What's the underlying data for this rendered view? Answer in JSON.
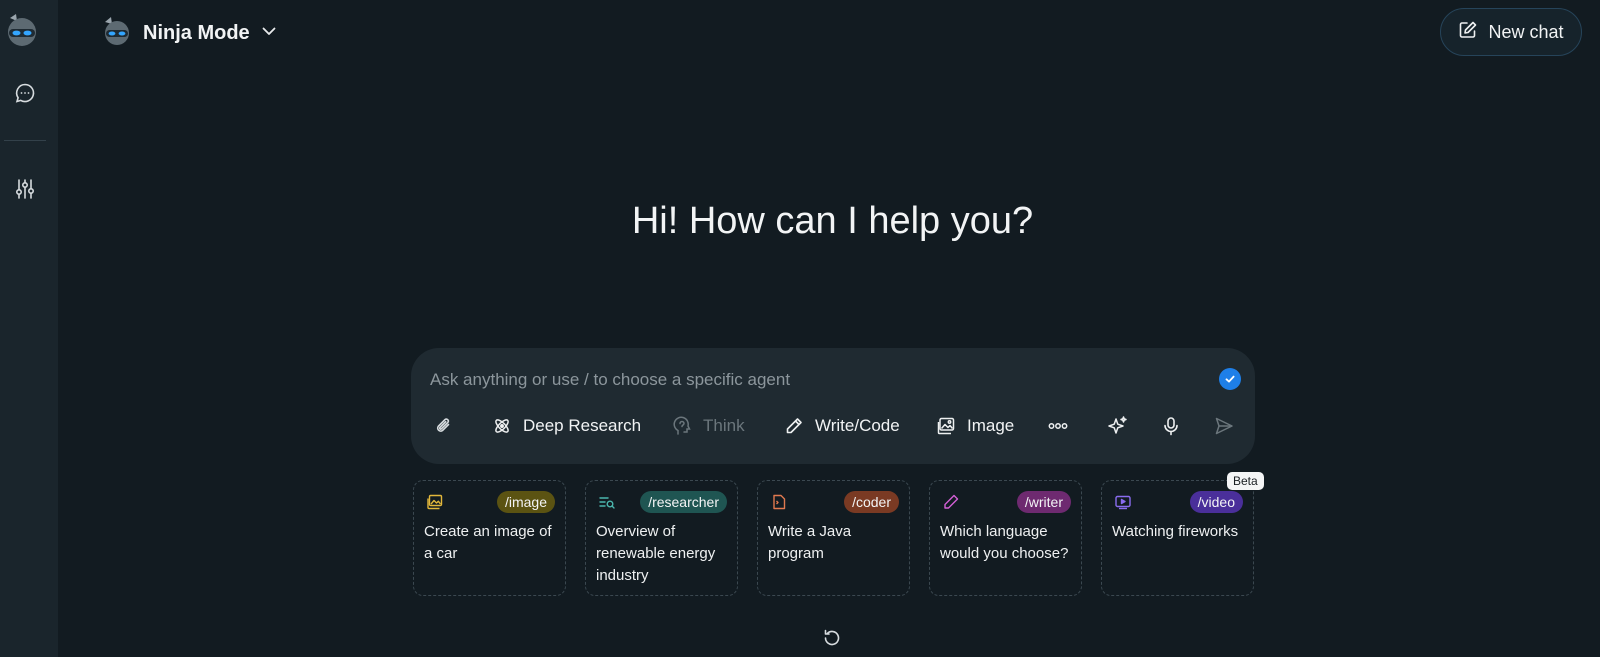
{
  "header": {
    "mode_label": "Ninja Mode",
    "new_chat_label": "New chat"
  },
  "sidebar": {
    "icons": [
      "ninja-logo-icon",
      "chat-bubble-icon",
      "sliders-icon"
    ]
  },
  "main": {
    "greeting": "Hi! How can I help you?"
  },
  "composer": {
    "placeholder": "Ask anything or use / to choose a specific agent",
    "value": "",
    "tools": {
      "deep_research": "Deep Research",
      "think": "Think",
      "write_code": "Write/Code",
      "image": "Image"
    }
  },
  "cards": [
    {
      "tag": "/image",
      "text": "Create an image of a car",
      "tag_color": "#5b5312",
      "icon_color": "#e2b73b"
    },
    {
      "tag": "/researcher",
      "text": "Overview of renewable energy industry",
      "tag_color": "#1f5552",
      "icon_color": "#4bb6ad"
    },
    {
      "tag": "/coder",
      "text": "Write a Java program",
      "tag_color": "#7a3a23",
      "icon_color": "#e0794f"
    },
    {
      "tag": "/writer",
      "text": "Which language would you choose?",
      "tag_color": "#6e2a70",
      "icon_color": "#d45fd6"
    },
    {
      "tag": "/video",
      "text": "Watching fireworks",
      "tag_color": "#4a2f9a",
      "icon_color": "#8a6cf0"
    }
  ],
  "badge": {
    "beta": "Beta"
  },
  "colors": {
    "background": "#121b21",
    "sidebar": "#1a252c",
    "composer": "#1f2a31",
    "accent_blue": "#1e7fe8"
  }
}
